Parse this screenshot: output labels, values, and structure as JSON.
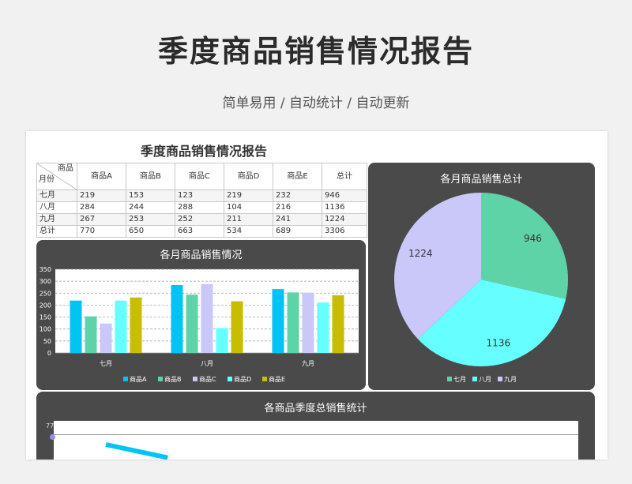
{
  "page": {
    "title": "季度商品销售情况报告",
    "subtitle": "简单易用 / 自动统计 / 自动更新"
  },
  "sheet": {
    "title": "季度商品销售情况报告",
    "corner": {
      "top": "商品",
      "bottom": "月份"
    },
    "table": {
      "columns": [
        "商品A",
        "商品B",
        "商品C",
        "商品D",
        "商品E",
        "总计"
      ],
      "rows": [
        {
          "label": "七月",
          "values": [
            "219",
            "153",
            "123",
            "219",
            "232",
            "946"
          ]
        },
        {
          "label": "八月",
          "values": [
            "284",
            "244",
            "288",
            "104",
            "216",
            "1136"
          ]
        },
        {
          "label": "九月",
          "values": [
            "267",
            "253",
            "252",
            "211",
            "241",
            "1224"
          ]
        },
        {
          "label": "总计",
          "values": [
            "770",
            "650",
            "663",
            "534",
            "689",
            "3306"
          ]
        }
      ]
    }
  },
  "colors": {
    "A": "#00c5f2",
    "B": "#5fd3a8",
    "C": "#c9c8f9",
    "D": "#66ffff",
    "E": "#c8bd00"
  },
  "chart_data": [
    {
      "type": "bar",
      "title": "各月商品销售情况",
      "categories": [
        "七月",
        "八月",
        "九月"
      ],
      "series": [
        {
          "name": "商品A",
          "values": [
            219,
            284,
            267
          ]
        },
        {
          "name": "商品B",
          "values": [
            153,
            244,
            253
          ]
        },
        {
          "name": "商品C",
          "values": [
            123,
            288,
            252
          ]
        },
        {
          "name": "商品D",
          "values": [
            219,
            104,
            211
          ]
        },
        {
          "name": "商品E",
          "values": [
            232,
            216,
            241
          ]
        }
      ],
      "yticks": [
        "0",
        "50",
        "100",
        "150",
        "200",
        "250",
        "300",
        "350"
      ],
      "ylim": [
        0,
        350
      ],
      "grid": true,
      "legend": "bottom"
    },
    {
      "type": "pie",
      "title": "各月商品销售总计",
      "labels": [
        "七月",
        "八月",
        "九月"
      ],
      "values": [
        946,
        1136,
        1224
      ],
      "colors": [
        "#5fd3a8",
        "#66ffff",
        "#c9c8f9"
      ],
      "legend": "bottom"
    },
    {
      "type": "line",
      "title": "各商品季度总销售统计",
      "visible_tick": "77"
    }
  ]
}
